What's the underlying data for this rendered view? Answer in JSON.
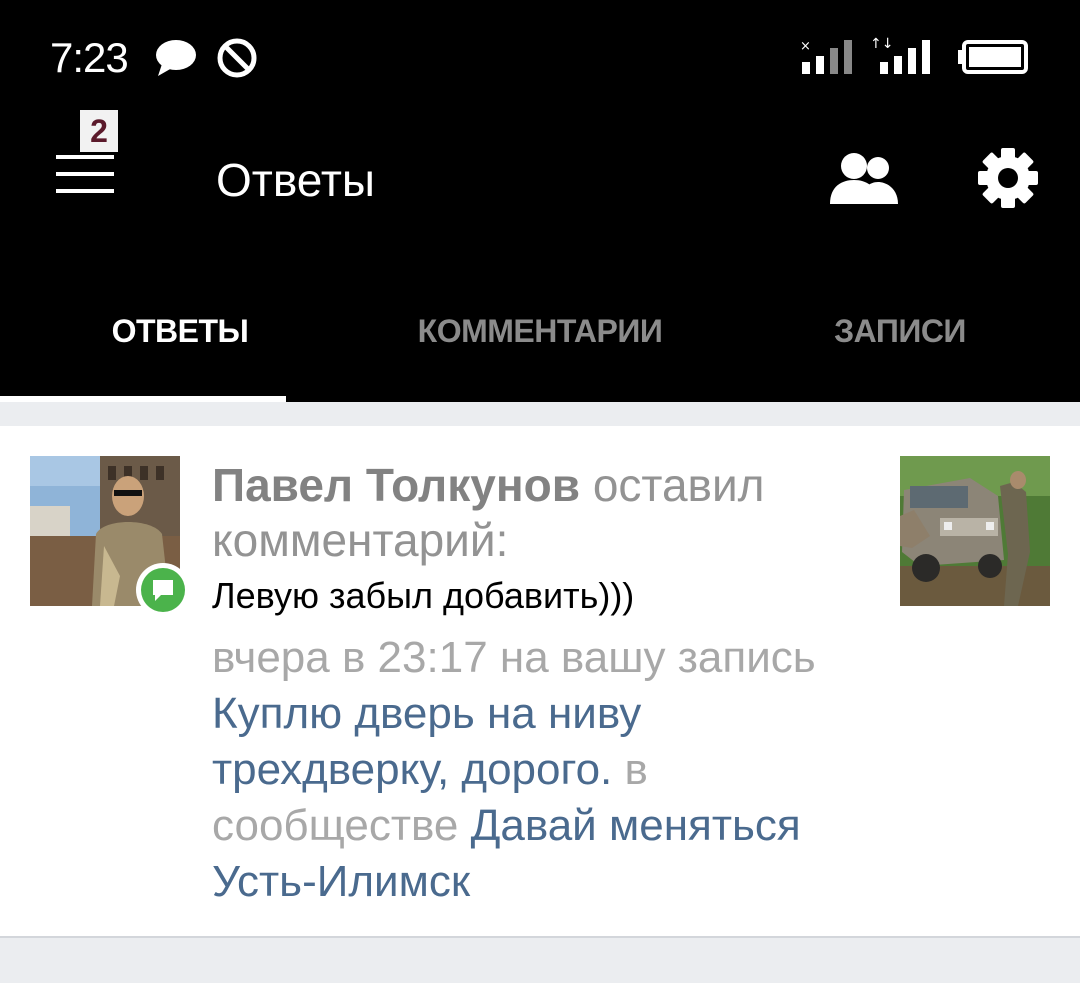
{
  "status_bar": {
    "time": "7:23"
  },
  "toolbar": {
    "title": "Ответы",
    "menu_badge": "2"
  },
  "tabs": [
    {
      "label": "ОТВЕТЫ",
      "active": true
    },
    {
      "label": "КОММЕНТАРИИ",
      "active": false
    },
    {
      "label": "ЗАПИСИ",
      "active": false
    }
  ],
  "notification": {
    "author": "Павел Толкунов",
    "action": "оставил комментарий:",
    "comment": "Левую забыл добавить)))",
    "time_prefix": "вчера в 23:17 на вашу запись",
    "post_title": "Куплю дверь на ниву трехдверку, дорого.",
    "community_prefix": "в сообществе",
    "community_name": "Давай меняться Усть-Илимск"
  },
  "colors": {
    "badge_green": "#4bb34b",
    "link_blue": "#4a6a8e",
    "background": "#ebedf0"
  }
}
